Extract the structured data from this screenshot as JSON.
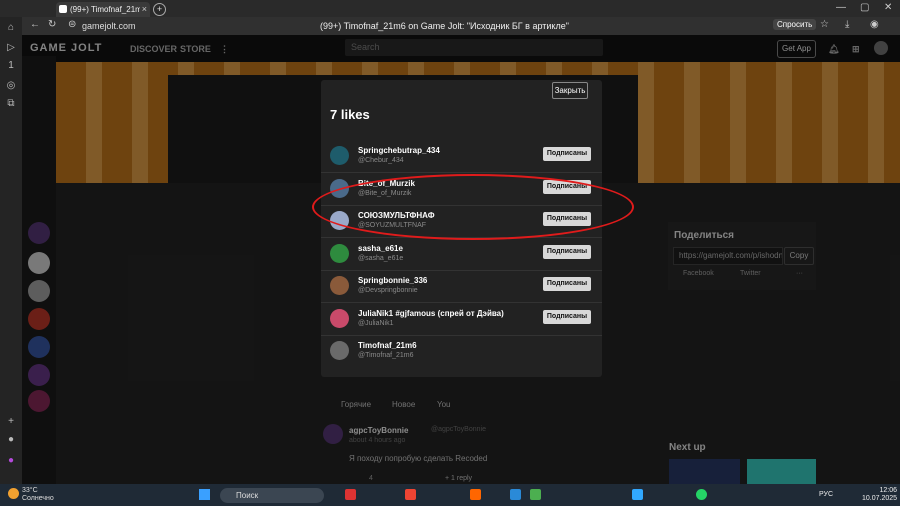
{
  "browser": {
    "tab_title": "(99+) Timofnaf_21m6 o",
    "tab_badge": "99+",
    "url": "gamejolt.com",
    "page_title": "(99+) Timofnaf_21m6 on Game Jolt: \"Исходник БГ в артикле\"",
    "ask_button": "Спросить"
  },
  "site": {
    "logo": "GAME JOLT",
    "nav": [
      "DISCOVER",
      "STORE"
    ],
    "search_placeholder": "Search",
    "get_app": "Get App"
  },
  "modal": {
    "close_label": "Закрыть",
    "title": "7 likes",
    "subscribe_label": "Подписаны",
    "users": [
      {
        "name": "Springchebutrap_434",
        "handle": "@Chebur_434",
        "color": "#1e5c6b",
        "subscribed": true
      },
      {
        "name": "Bite_of_Murzik",
        "handle": "@Bite_of_Murzik",
        "color": "#4a6a8a",
        "subscribed": true
      },
      {
        "name": "СОЮЗМУЛЬТФНАФ",
        "handle": "@SOYUZMULTFNAF",
        "color": "#9aa9c9",
        "subscribed": true
      },
      {
        "name": "sasha_e61e",
        "handle": "@sasha_e61e",
        "color": "#2e8b3e",
        "subscribed": true
      },
      {
        "name": "Springbonnie_336",
        "handle": "@Devspringbonnie",
        "color": "#8a5a3a",
        "subscribed": true
      },
      {
        "name": "JuliaNik1 #gjfamous (спрей от Дэйва)",
        "handle": "@JuliaNik1",
        "color": "#c94a6a",
        "subscribed": true
      },
      {
        "name": "Timofnaf_21m6",
        "handle": "@Timofnaf_21m6",
        "color": "#6a6a6a",
        "subscribed": false
      }
    ]
  },
  "share": {
    "title": "Поделиться",
    "url": "https://gamejolt.com/p/ishodnl",
    "copy": "Copy",
    "facebook": "Facebook",
    "twitter": "Twitter",
    "more": "···"
  },
  "comments": {
    "tabs": [
      "Горячие",
      "Новое",
      "You"
    ],
    "author": "agpcToyBonnie",
    "author_handle": "@agpcToyBonnie",
    "time": "about 4 hours ago",
    "text": "Я походу попробую сделать Recoded",
    "likes": "4",
    "reply": "+ 1 reply"
  },
  "next_up": "Next up",
  "taskbar": {
    "temp": "33°C",
    "weather": "Солнечно",
    "search": "Поиск",
    "lang": "РУС",
    "time": "12:06",
    "date": "10.07.2025"
  },
  "colors": {
    "annotation": "#e01b1b",
    "subscribe_bg": "#d8d8d8"
  }
}
